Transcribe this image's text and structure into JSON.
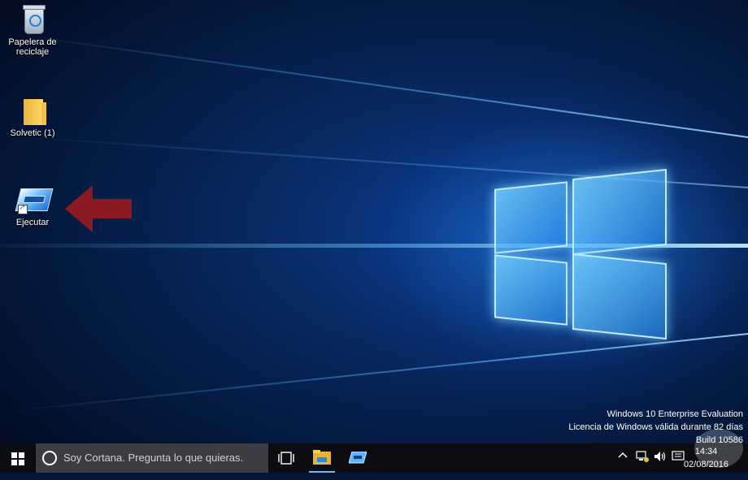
{
  "desktop": {
    "icons": [
      {
        "label": "Papelera de reciclaje",
        "label_line1": "Papelera de",
        "label_line2": "reciclaje",
        "icon": "recycle-bin-icon"
      },
      {
        "label": "Solvetic (1)",
        "icon": "folder-icon"
      },
      {
        "label": "Ejecutar",
        "icon": "run-dialog-icon"
      }
    ],
    "annotation_arrow_color": "#8b1a22"
  },
  "watermark": {
    "line1": "Windows 10 Enterprise Evaluation",
    "line2": "Licencia de Windows válida durante 82 días",
    "line3": "Build 10586"
  },
  "taskbar": {
    "search_placeholder": "Soy Cortana. Pregunta lo que quieras.",
    "pinned": [
      {
        "name": "task-view",
        "icon": "task-view-icon"
      },
      {
        "name": "file-explorer",
        "icon": "file-explorer-icon",
        "active": true
      },
      {
        "name": "run",
        "icon": "run-dialog-icon"
      }
    ],
    "tray": {
      "icons": [
        "chevron-up-icon",
        "network-icon",
        "volume-icon",
        "notification-icon"
      ],
      "time": "14:34",
      "date": "02/08/2016"
    }
  },
  "colors": {
    "accent": "#0a78d7",
    "taskbar_bg": "#0b0d12",
    "search_bg": "#3b3d42"
  }
}
